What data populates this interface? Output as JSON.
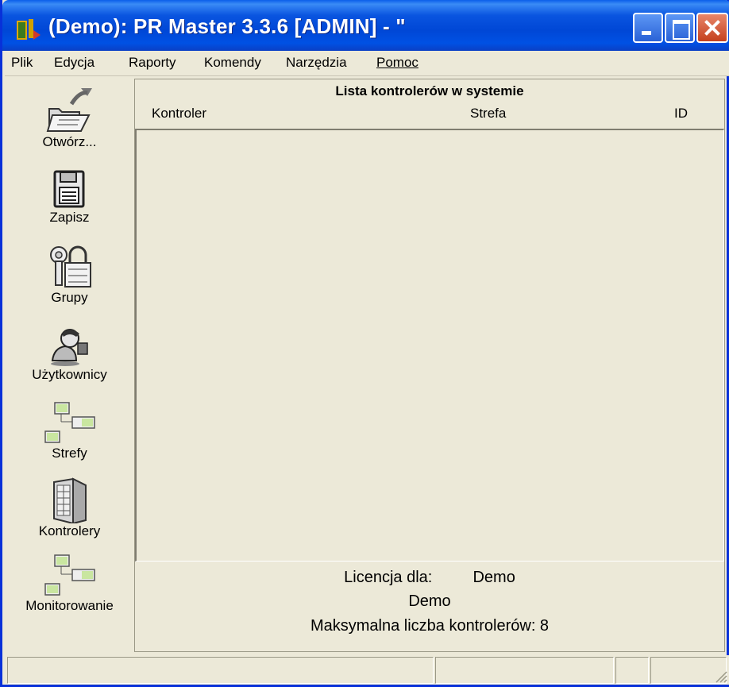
{
  "window": {
    "title": "(Demo): PR Master 3.3.6 [ADMIN] - \""
  },
  "menu": {
    "items": [
      "Plik",
      "Edycja",
      "Raporty",
      "Komendy",
      "Narzędzia",
      "Pomoc"
    ]
  },
  "toolbar": {
    "items": [
      {
        "label": "Otwórz...",
        "icon": "open-folder-icon"
      },
      {
        "label": "Zapisz",
        "icon": "save-floppy-icon"
      },
      {
        "label": "Grupy",
        "icon": "keys-lock-icon"
      },
      {
        "label": "Użytkownicy",
        "icon": "user-icon"
      },
      {
        "label": "Strefy",
        "icon": "zones-icon"
      },
      {
        "label": "Kontrolery",
        "icon": "controller-icon"
      },
      {
        "label": "Monitorowanie",
        "icon": "monitoring-icon"
      }
    ]
  },
  "controllers": {
    "title": "Lista kontrolerów w systemie",
    "columns": [
      "Kontroler",
      "Strefa",
      "ID"
    ],
    "rows": []
  },
  "license": {
    "label": "Licencja dla:",
    "licensee": "Demo",
    "company": "Demo",
    "max_controllers": "Maksymalna liczba kontrolerów: 8"
  },
  "colors": {
    "titlebar": "#0054e3",
    "window_bg": "#ece9d8",
    "close_button": "#d0522f"
  }
}
